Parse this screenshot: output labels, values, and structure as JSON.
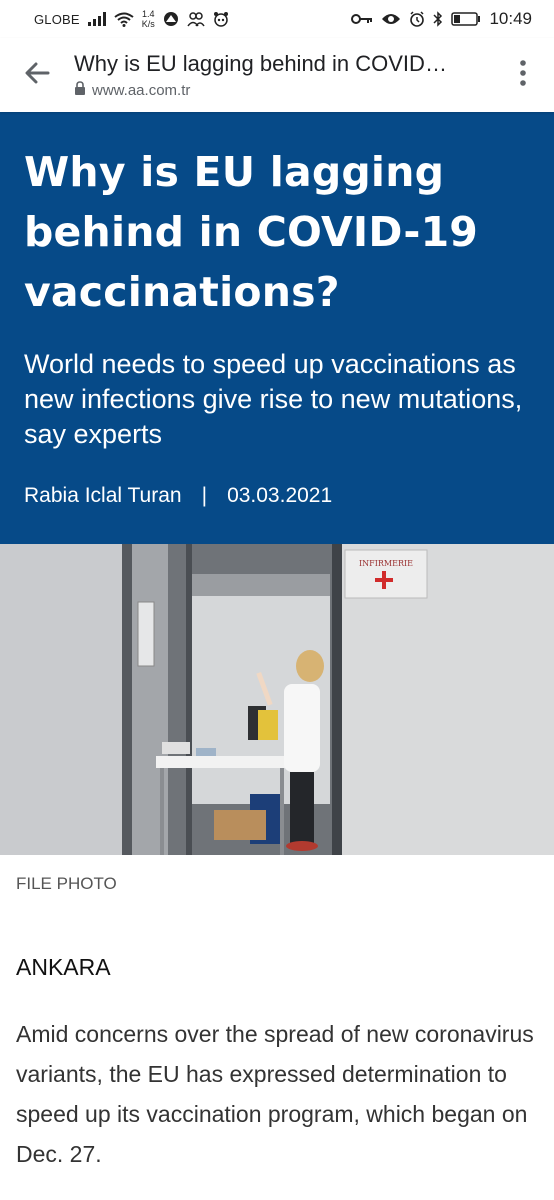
{
  "status_bar": {
    "carrier": "GLOBE",
    "net_speed_value": "1.4",
    "net_speed_unit": "K/s",
    "time": "10:49"
  },
  "toolbar": {
    "title": "Why is EU lagging behind in COVID-19 vaccinations?",
    "url": "www.aa.com.tr"
  },
  "article": {
    "headline": "Why is EU lagging behind in COVID-19 vaccinations?",
    "subheadline": "World needs to speed up vaccinations as new infections give rise to new mutations, say experts",
    "author": "Rabia Iclal Turan",
    "separator": "|",
    "date": "03.03.2021",
    "photo_sign": "INFIRMERIE",
    "photo_caption": "FILE PHOTO",
    "dateline": "ANKARA",
    "body": "Amid concerns over the spread of new coronavirus variants, the EU has expressed determination to speed up its vaccination program, which began on Dec. 27."
  },
  "colors": {
    "hero_background": "#064a88",
    "hero_text": "#ffffff"
  }
}
